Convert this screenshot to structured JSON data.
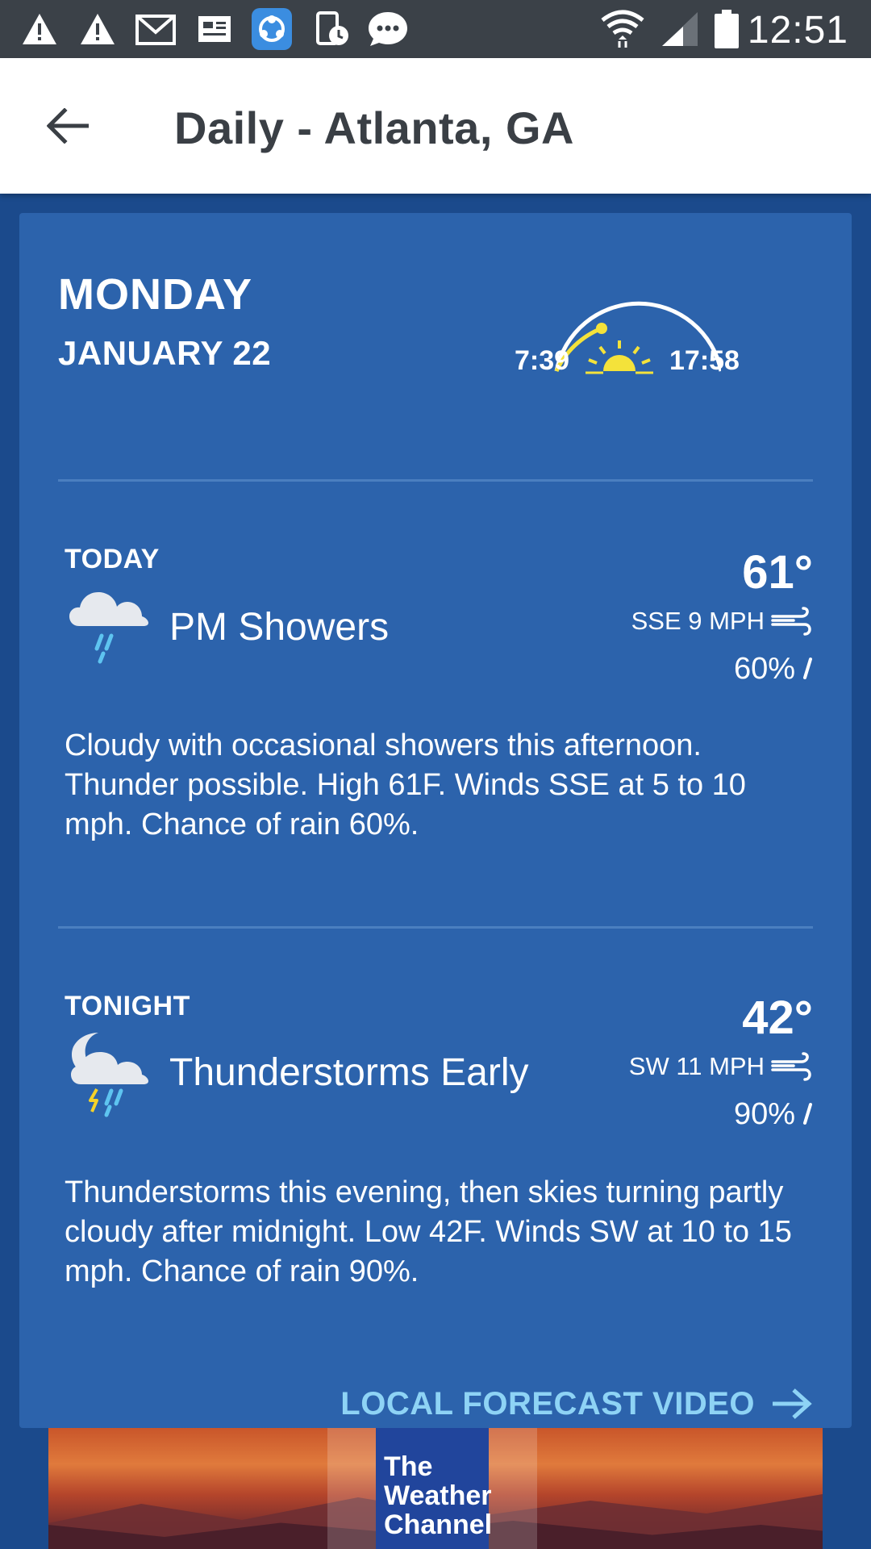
{
  "status_bar": {
    "time": "12:51",
    "icons": [
      "warning-icon",
      "warning-icon",
      "gmail-icon",
      "news-icon",
      "share-app-icon",
      "screen-timer-icon",
      "messaging-icon",
      "wifi-icon",
      "cell-signal-icon",
      "battery-icon"
    ]
  },
  "app_bar": {
    "back_icon": "arrow-left-icon",
    "title": "Daily - Atlanta, GA"
  },
  "day": {
    "name": "MONDAY",
    "date": "JANUARY 22",
    "sunrise": "7:39",
    "sunset": "17:58",
    "sun_icon": "sunrise-icon"
  },
  "periods": [
    {
      "label": "TODAY",
      "condition": "PM Showers",
      "icon": "cloud-rain-icon",
      "temp": "61°",
      "wind": "SSE 9 MPH",
      "precip": "60%",
      "description": "Cloudy with occasional showers this afternoon. Thunder possible. High 61F. Winds SSE at 5 to 10 mph. Chance of rain 60%."
    },
    {
      "label": "TONIGHT",
      "condition": "Thunderstorms Early",
      "icon": "moon-thunderstorm-icon",
      "temp": "42°",
      "wind": "SW 11 MPH",
      "precip": "90%",
      "description": "Thunderstorms this evening, then skies turning partly cloudy after midnight. Low 42F. Winds SW at 10 to 15 mph. Chance of rain 90%."
    }
  ],
  "video_link": {
    "label": "LOCAL FORECAST VIDEO"
  },
  "ad": {
    "logo_lines": [
      "The",
      "Weather",
      "Channel"
    ]
  },
  "colors": {
    "background": "#1b4a8c",
    "card": "#2c63ac",
    "status_bar": "#3b4148",
    "link": "#8ed3f5",
    "sun": "#f4e23a"
  }
}
